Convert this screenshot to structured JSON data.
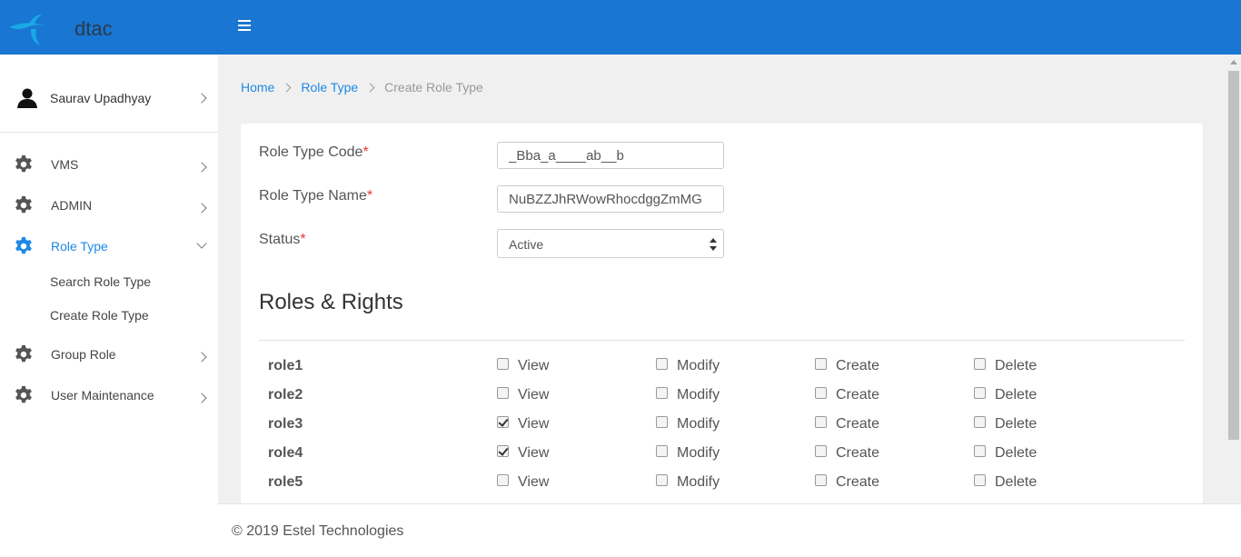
{
  "header": {
    "brand": "dtac",
    "colors": {
      "bar": "#1976d2",
      "logo": "#19a9e5"
    },
    "menu_icon": "hamburger-icon"
  },
  "sidebar": {
    "user": {
      "name": "Saurav Upadhyay",
      "icon": "user-icon"
    },
    "items": [
      {
        "label": "VMS",
        "icon": "gear-icon",
        "expanded": false
      },
      {
        "label": "ADMIN",
        "icon": "gear-icon",
        "expanded": false
      },
      {
        "label": "Role Type",
        "icon": "gear-icon",
        "expanded": true,
        "active": true,
        "children": [
          {
            "label": "Search Role Type"
          },
          {
            "label": "Create Role Type"
          }
        ]
      },
      {
        "label": "Group Role",
        "icon": "gear-icon",
        "expanded": false
      },
      {
        "label": "User Maintenance",
        "icon": "gear-icon",
        "expanded": false
      }
    ],
    "active_color": "#1e88e5"
  },
  "breadcrumb": {
    "home": "Home",
    "parent": "Role Type",
    "current": "Create Role Type"
  },
  "form": {
    "code": {
      "label": "Role Type Code",
      "required": "*",
      "value": "_Bba_a____ab__b"
    },
    "name": {
      "label": "Role Type Name",
      "required": "*",
      "value": "NuBZZJhRWowRhocdggZmMG"
    },
    "status": {
      "label": "Status",
      "required": "*",
      "value": "Active"
    }
  },
  "roles_section": {
    "title": "Roles & Rights",
    "permission_labels": [
      "View",
      "Modify",
      "Create",
      "Delete"
    ],
    "roles": [
      {
        "name": "role1",
        "view": false,
        "modify": false,
        "create": false,
        "delete": false
      },
      {
        "name": "role2",
        "view": false,
        "modify": false,
        "create": false,
        "delete": false
      },
      {
        "name": "role3",
        "view": true,
        "modify": false,
        "create": false,
        "delete": false
      },
      {
        "name": "role4",
        "view": true,
        "modify": false,
        "create": false,
        "delete": false
      },
      {
        "name": "role5",
        "view": false,
        "modify": false,
        "create": false,
        "delete": false
      }
    ]
  },
  "footer": {
    "text": "© 2019 Estel Technologies"
  }
}
